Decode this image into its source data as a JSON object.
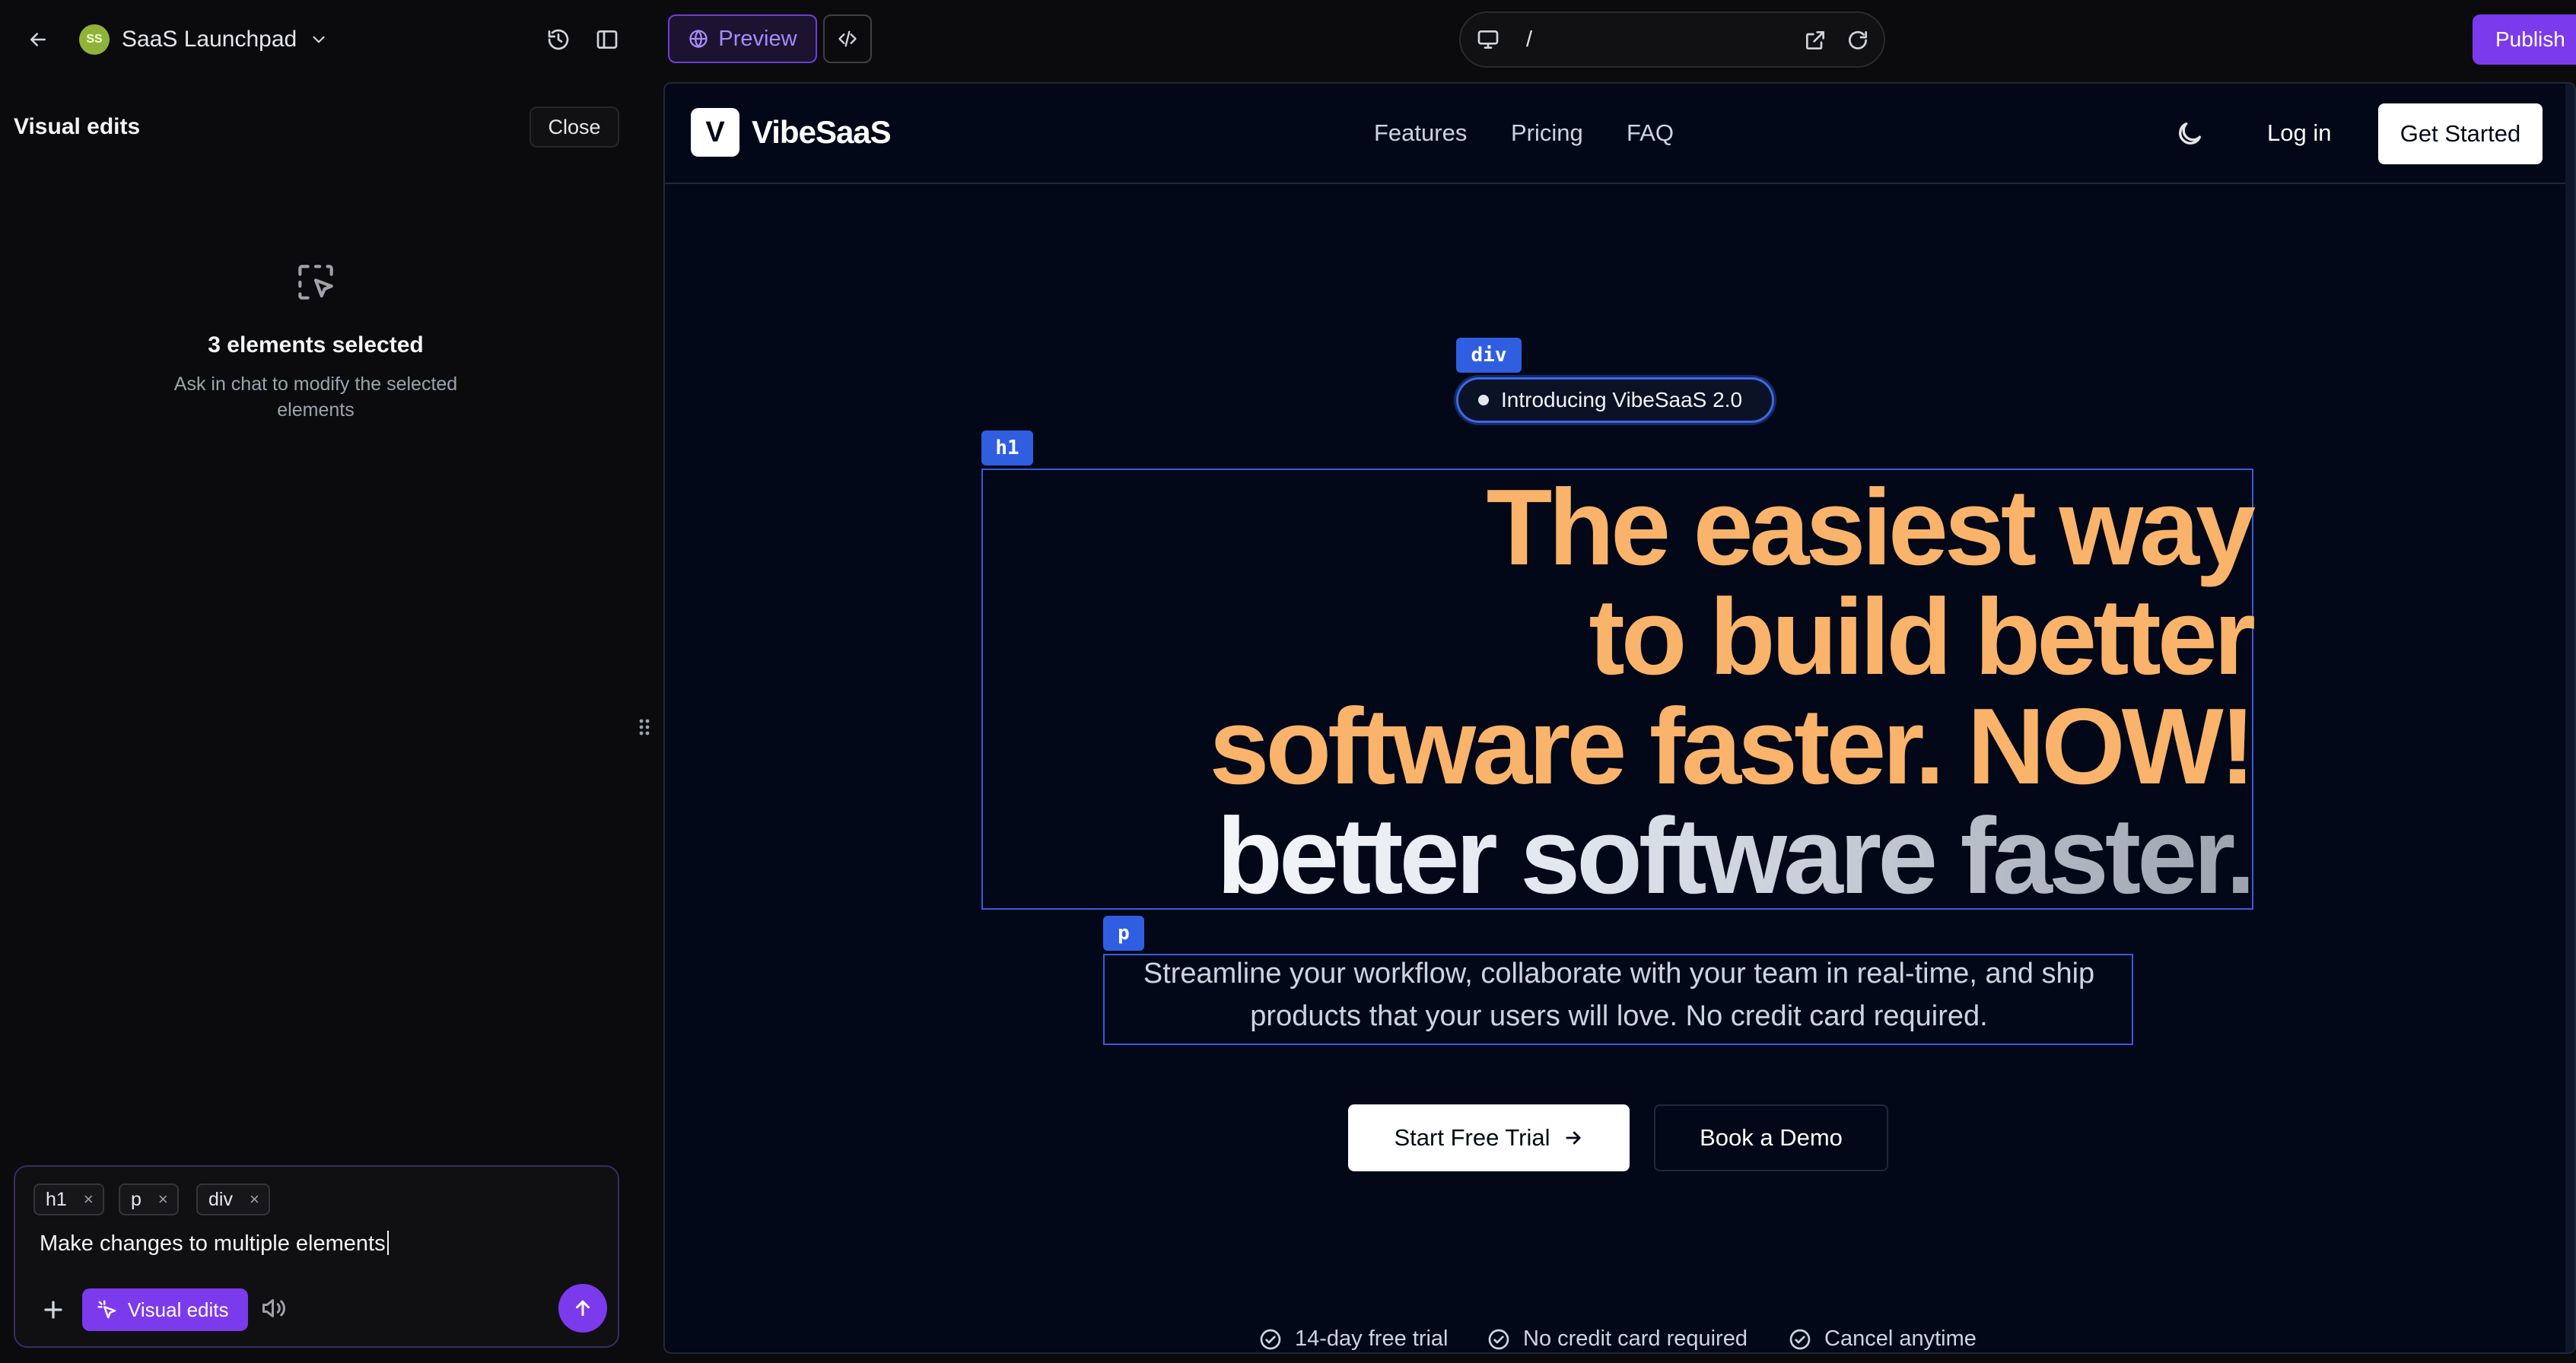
{
  "topbar": {
    "project_initials": "SS",
    "project_name": "SaaS Launchpad",
    "preview_label": "Preview",
    "url_path": "/",
    "publish_label": "Publish"
  },
  "panel": {
    "title": "Visual edits",
    "close_label": "Close",
    "selection_count": "3 elements selected",
    "selection_hint": "Ask in chat to modify the selected elements"
  },
  "chat": {
    "chips": [
      "h1",
      "p",
      "div"
    ],
    "chip_close": "×",
    "input_value": "Make changes to multiple elements",
    "visual_edits_label": "Visual edits"
  },
  "site": {
    "logo_letter": "V",
    "brand": "VibeSaaS",
    "nav": [
      "Features",
      "Pricing",
      "FAQ"
    ],
    "login": "Log in",
    "get_started": "Get Started",
    "badge": "Introducing VibeSaaS 2.0",
    "headline_lines": [
      "The easiest way",
      "to build better",
      "software faster. NOW!",
      "better software faster."
    ],
    "subtitle": "Streamline your workflow, collaborate with your team in real-time, and ship products that your users will love. No credit card required.",
    "cta_primary": "Start Free Trial",
    "cta_secondary": "Book a Demo",
    "perks": [
      "14-day free trial",
      "No credit card required",
      "Cancel anytime"
    ]
  },
  "selection_tags": {
    "div": "div",
    "h1": "h1",
    "p": "p"
  },
  "colors": {
    "accent_purple": "#7c3aed",
    "selection_blue": "#2f5fe0",
    "headline_orange": "#f9b36a",
    "preview_bg": "#020817"
  }
}
